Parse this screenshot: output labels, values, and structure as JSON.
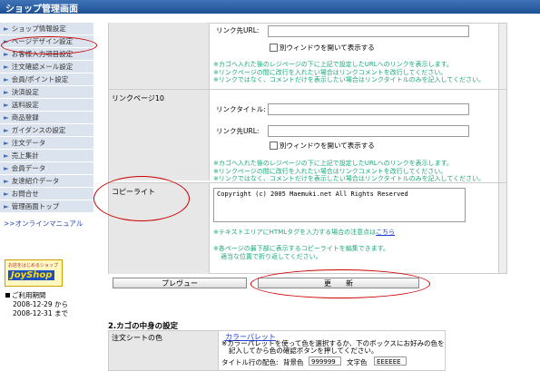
{
  "header": {
    "title": "ショップ管理画面"
  },
  "sidebar": {
    "items": [
      {
        "label": "ショップ情報設定"
      },
      {
        "label": "ページデザイン設定"
      },
      {
        "label": "お客様入力項目設定"
      },
      {
        "label": "注文確認メール設定"
      },
      {
        "label": "会員/ポイント設定"
      },
      {
        "label": "決済設定"
      },
      {
        "label": "送料設定"
      },
      {
        "label": "商品登録"
      },
      {
        "label": "ガイダンスの設定"
      },
      {
        "label": "注文データ"
      },
      {
        "label": "売上集計"
      },
      {
        "label": "会員データ"
      },
      {
        "label": "友達紹介データ"
      },
      {
        "label": "お問合せ"
      },
      {
        "label": "管理画面トップ"
      }
    ],
    "manual_link": ">>オンラインマニュアル",
    "logo": {
      "small": "お店をはじめるショップ",
      "big": "JoyShop"
    },
    "period": {
      "title": "ご利用期間",
      "line1": "2008-12-29 から",
      "line2": "2008-12-31 まで"
    }
  },
  "link9": {
    "url_label": "リンク先URL:",
    "newwin_label": "別ウィンドウを開いて表示する",
    "notes": [
      "※カゴへ入れた後のレジページの下に上記で設定したURLへのリンクを表示します。",
      "※リンクページの間に改行を入れたい場合はリンクコメントを改行してください。",
      "※リンクではなく、コメントだけを表示したい場合はリンクタイトルのみを記入してください。"
    ]
  },
  "link10": {
    "row_label": "リンクページ10",
    "title_label": "リンクタイトル:",
    "url_label": "リンク先URL:",
    "newwin_label": "別ウィンドウを開いて表示する",
    "notes": [
      "※カゴへ入れた後のレジページの下に上記で設定したURLへのリンクを表示します。",
      "※リンクページの間に改行を入れたい場合はリンクコメントを改行してください。",
      "※リンクではなく、コメントだけを表示したい場合はリンクタイトルのみを記入してください。"
    ]
  },
  "copyright": {
    "row_label": "コピーライト",
    "value": "Copyright (c) 2005 Maemuki.net All Rights Reserved",
    "html_note": "※テキストエリアにHTMLタグを入力する場合の注意点は",
    "html_note_link": "こちら",
    "note1": "※各ページの最下部に表示するコピーライトを編集できます。",
    "note2": "適当な位置で折り返してください。"
  },
  "buttons": {
    "preview": "プレヴュー",
    "update": "更　　新"
  },
  "section2": {
    "title": "2.カゴの中身の設定",
    "row_label": "注文シートの色",
    "palette_link": "カラーパレット",
    "desc1": "※カラーパレットを使って色を選択するか、下のボックスにお好みの色を",
    "desc2": "記入してから色の確認ボタンを押してください。",
    "title_row_label": "タイトル行の配色:",
    "bg_label": "背景色",
    "bg_value": "999999",
    "fg_label": "文字色",
    "fg_value": "EEEEEE"
  }
}
